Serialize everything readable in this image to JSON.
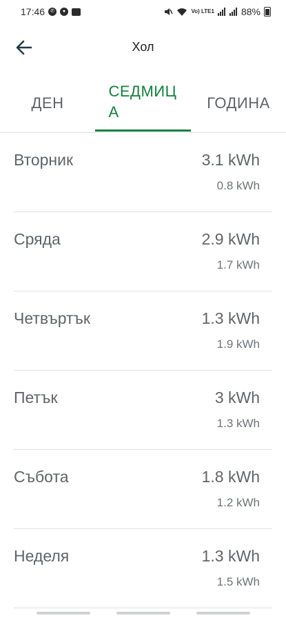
{
  "status_bar": {
    "time": "17:46",
    "battery": "88%",
    "lte": "Vo) LTE1",
    "icons_left": [
      "viber-icon",
      "app-icon",
      "app-icon"
    ],
    "icons_right": [
      "mute-icon",
      "wifi-icon",
      "signal-icon",
      "signal-icon",
      "battery-icon"
    ]
  },
  "header": {
    "title": "Хол",
    "back_icon": "arrow-back-icon"
  },
  "tabs": [
    {
      "label": "ДЕН",
      "selected": false
    },
    {
      "label": "СЕДМИЦА",
      "selected": true
    },
    {
      "label": "ГОДИНА",
      "selected": false
    }
  ],
  "accent_color": "#12803c",
  "rows": [
    {
      "day": "Вторник",
      "value": "3.1 kWh",
      "sub": "0.8 kWh"
    },
    {
      "day": "Сряда",
      "value": "2.9 kWh",
      "sub": "1.7 kWh"
    },
    {
      "day": "Четвъртък",
      "value": "1.3 kWh",
      "sub": "1.9 kWh"
    },
    {
      "day": "Петък",
      "value": "3 kWh",
      "sub": "1.3 kWh"
    },
    {
      "day": "Събота",
      "value": "1.8 kWh",
      "sub": "1.2 kWh"
    },
    {
      "day": "Неделя",
      "value": "1.3 kWh",
      "sub": "1.5 kWh"
    }
  ]
}
